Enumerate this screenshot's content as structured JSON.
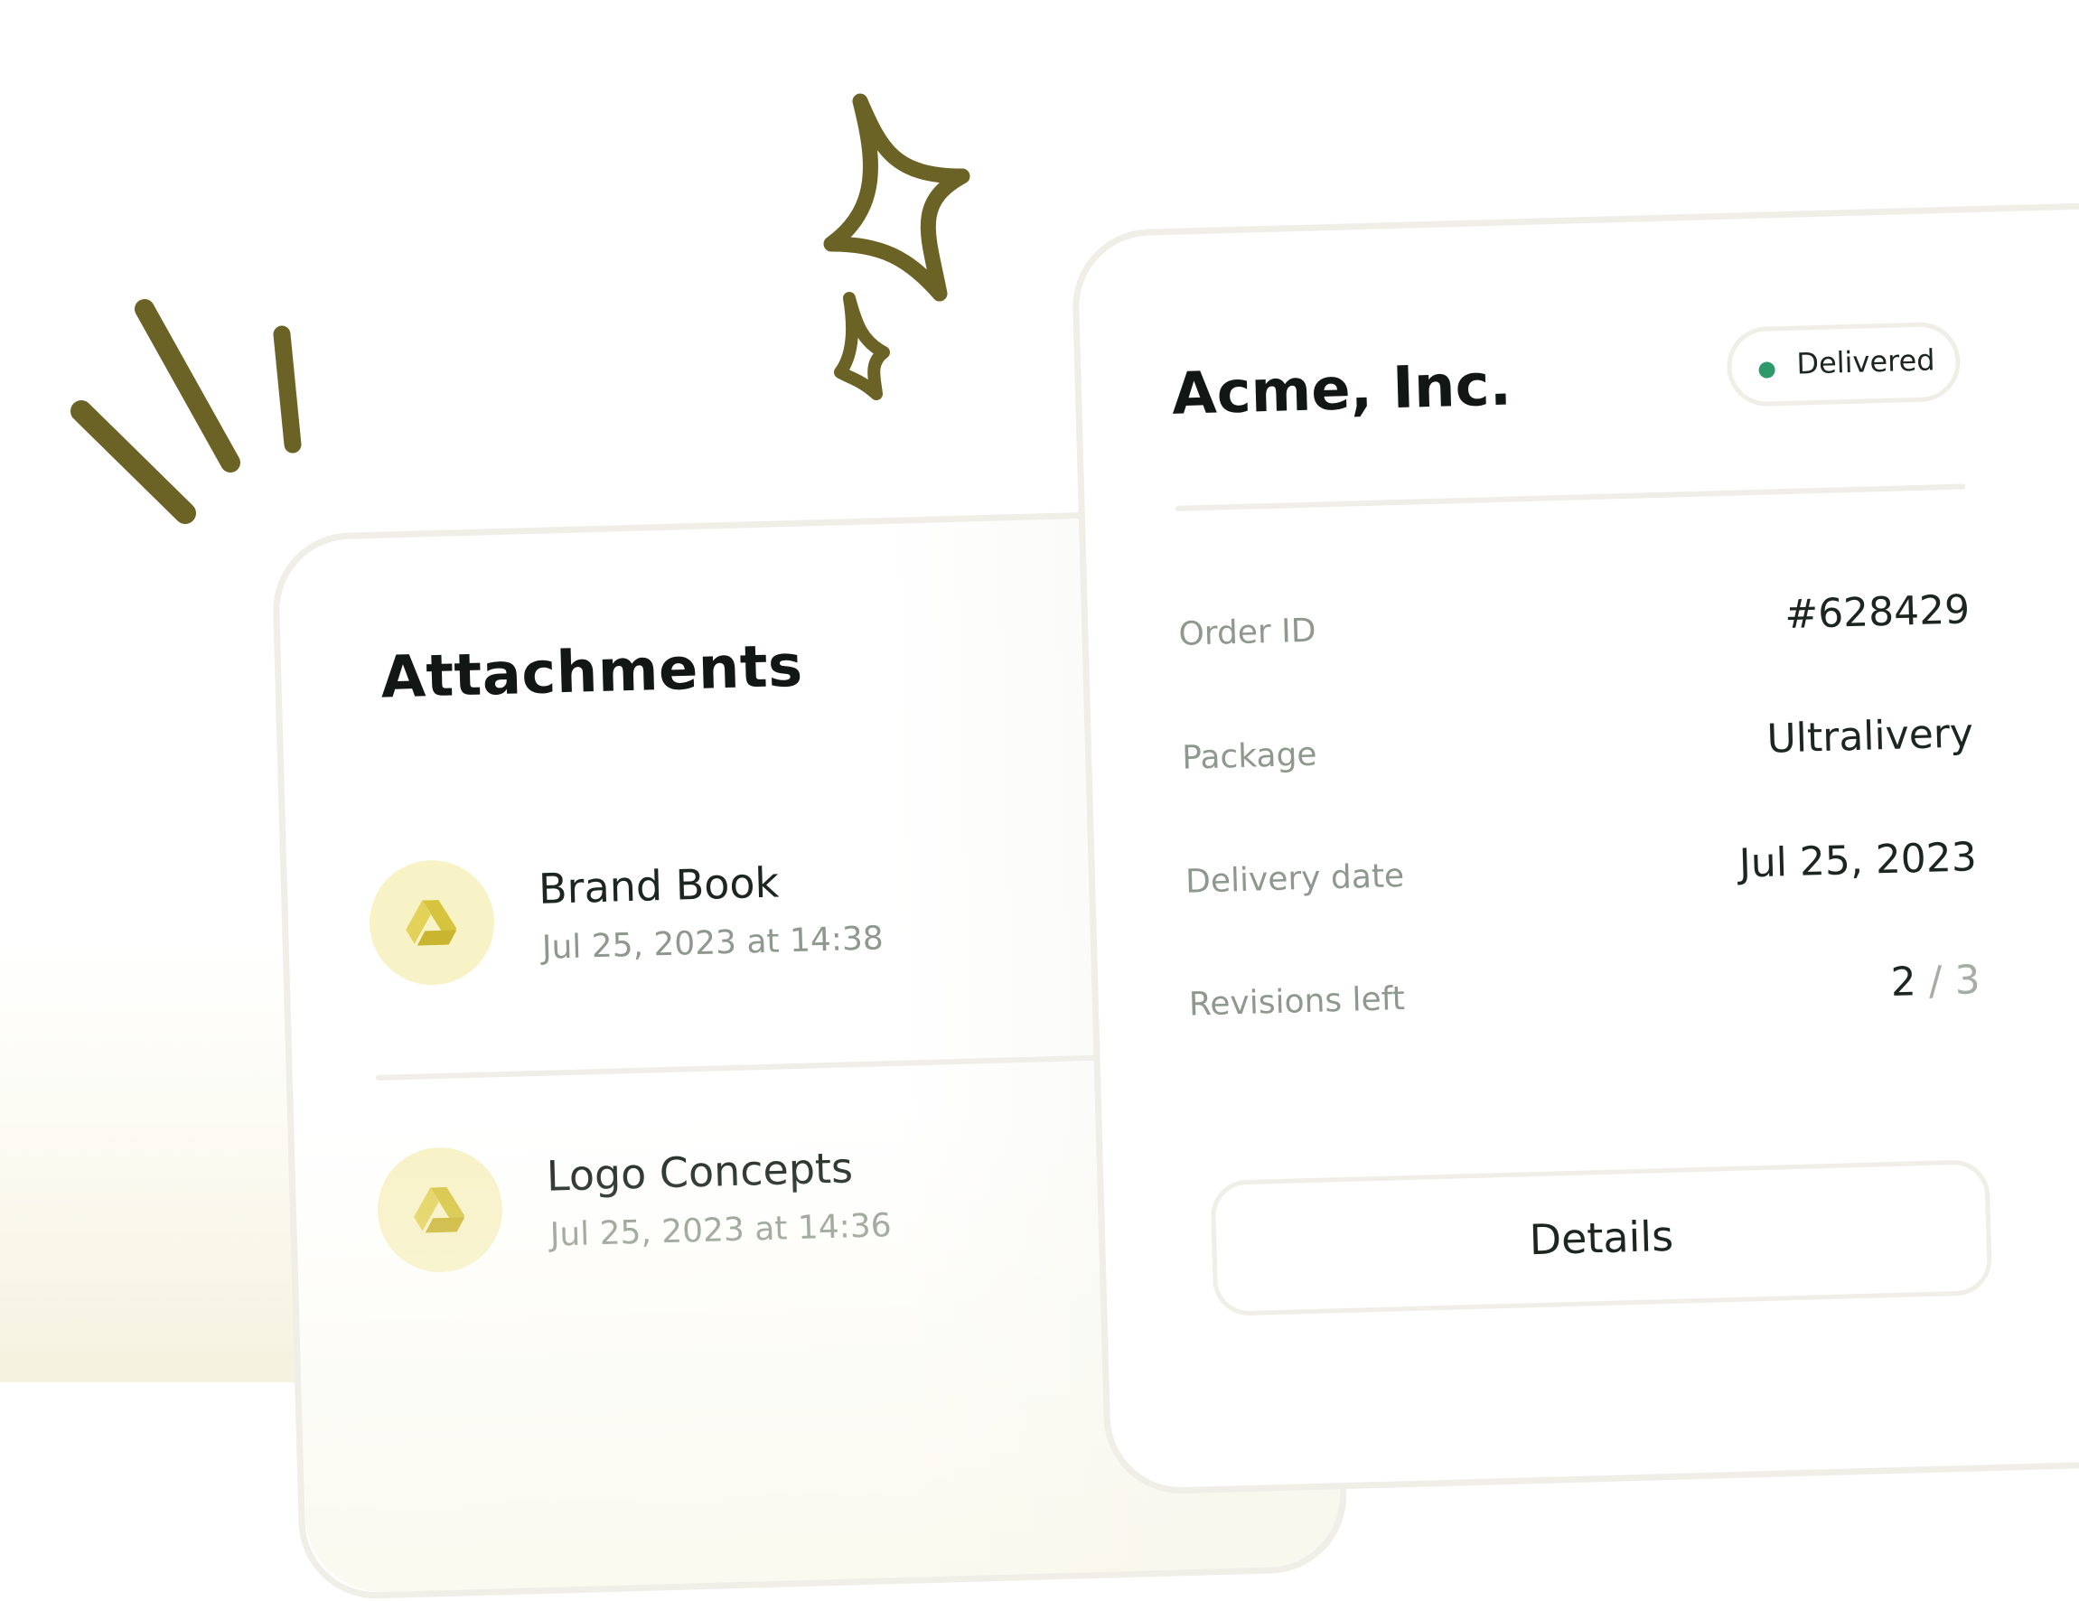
{
  "attachments": {
    "title": "Attachments",
    "items": [
      {
        "name": "Brand Book",
        "date": "Jul 25, 2023 at 14:38",
        "icon": "google-drive-icon"
      },
      {
        "name": "Logo Concepts",
        "date": "Jul 25, 2023 at 14:36",
        "icon": "google-drive-icon"
      }
    ]
  },
  "order": {
    "company": "Acme, Inc.",
    "status": "Delivered",
    "rows": [
      {
        "label": "Order ID",
        "value": "#628429"
      },
      {
        "label": "Package",
        "value": "Ultralivery"
      },
      {
        "label": "Delivery date",
        "value": "Jul 25, 2023"
      },
      {
        "label": "Revisions left",
        "value_used": "2",
        "value_total": "/ 3"
      }
    ],
    "details_label": "Details"
  },
  "colors": {
    "doodle": "#6b6325",
    "status_dot": "#2e9a6b",
    "icon_bg": "#f8f2c7",
    "icon_fg": "#d7c43e"
  }
}
